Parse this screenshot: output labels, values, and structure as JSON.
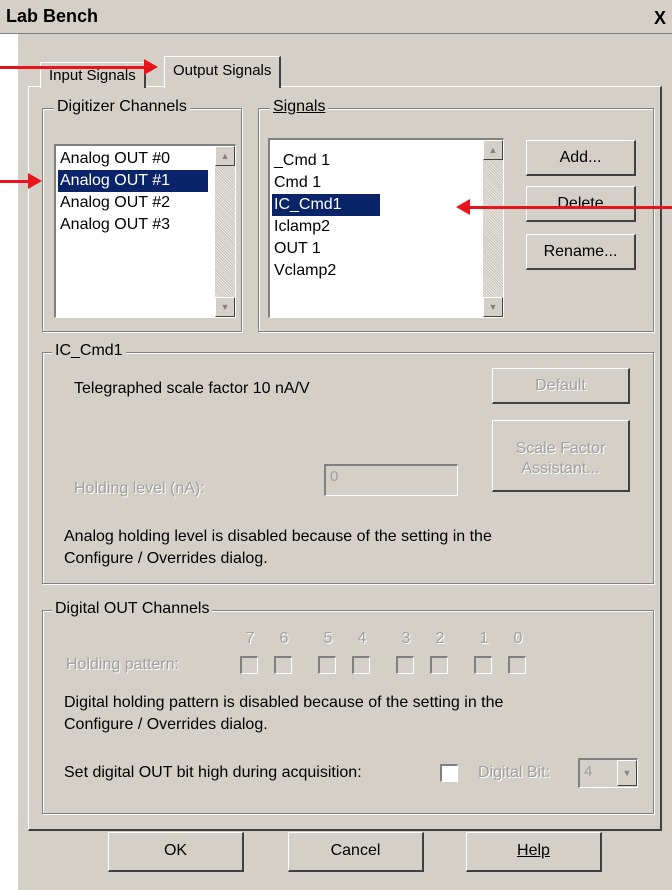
{
  "window": {
    "title": "Lab Bench",
    "close_label": "X"
  },
  "tabs": [
    {
      "label": "Input Signals",
      "active": false
    },
    {
      "label": "Output Signals",
      "active": true
    }
  ],
  "digitizer": {
    "group_label": "Digitizer Channels",
    "items": [
      "Analog OUT #0",
      "Analog OUT #1",
      "Analog OUT #2",
      "Analog OUT #3"
    ],
    "selected_index": 1
  },
  "signals": {
    "group_label": "Signals",
    "items": [
      "_Cmd 1",
      "Cmd 1",
      "IC_Cmd1",
      "Iclamp2",
      "OUT 1",
      "Vclamp2"
    ],
    "selected_index": 2,
    "buttons": {
      "add": "Add...",
      "delete": "Delete",
      "rename": "Rename..."
    }
  },
  "signal_details": {
    "group_label": "IC_Cmd1",
    "scale_factor_text": "Telegraphed scale factor 10 nA/V",
    "default_button": "Default",
    "scale_assistant_line1": "Scale Factor",
    "scale_assistant_line2": "Assistant...",
    "holding_label": "Holding level (nA):",
    "holding_value": "0",
    "disabled_note_line1": "Analog holding level is disabled because of the setting in the",
    "disabled_note_line2": "Configure / Overrides dialog."
  },
  "digital_out": {
    "group_label": "Digital OUT Channels",
    "bit_labels": [
      "7",
      "6",
      "5",
      "4",
      "3",
      "2",
      "1",
      "0"
    ],
    "holding_pattern_label": "Holding pattern:",
    "disabled_note_line1": "Digital holding pattern is disabled because of the setting in the",
    "disabled_note_line2": "Configure / Overrides dialog.",
    "bit_high_label": "Set digital OUT bit high during acquisition:",
    "digital_bit_label": "Digital Bit:",
    "digital_bit_value": "4"
  },
  "footer": {
    "ok": "OK",
    "cancel": "Cancel",
    "help": "Help"
  },
  "colors": {
    "dialog_bg": "#d4d0c8",
    "selection": "#0a246a",
    "annotation_arrow": "#e8141b"
  }
}
